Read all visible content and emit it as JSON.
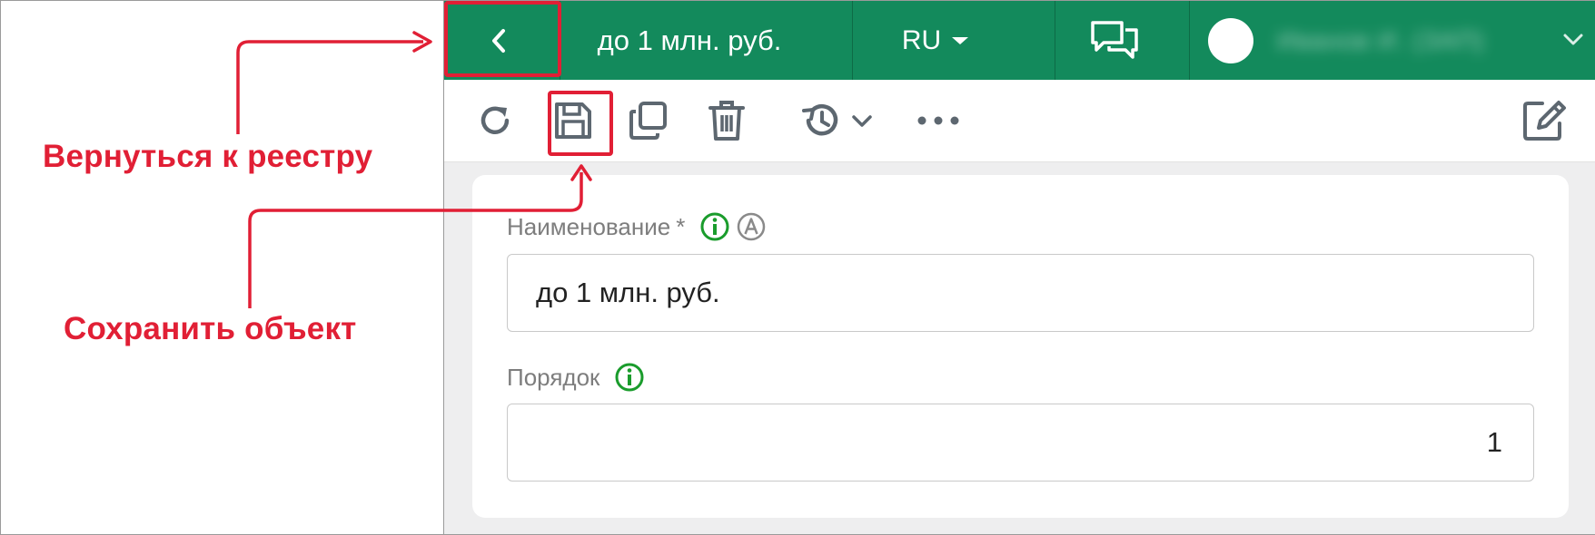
{
  "annotations": {
    "back_label": "Вернуться к реестру",
    "save_label": "Сохранить объект",
    "accent_color": "#e11f35"
  },
  "topbar": {
    "background": "#138a5c",
    "back_icon": "chevron-left-icon",
    "title": "до 1 млн. руб.",
    "language": "RU",
    "chat_icon": "chat-bubbles-icon",
    "user_name": "Иванов И. (ЗАП)"
  },
  "toolbar": {
    "icons": [
      "refresh-icon",
      "save-icon",
      "copy-icon",
      "delete-icon",
      "history-icon",
      "more-icon",
      "edit-icon"
    ]
  },
  "form": {
    "name_field": {
      "label": "Наименование",
      "required_mark": "*",
      "value": "до 1 млн. руб."
    },
    "order_field": {
      "label": "Порядок",
      "value": "1"
    }
  }
}
